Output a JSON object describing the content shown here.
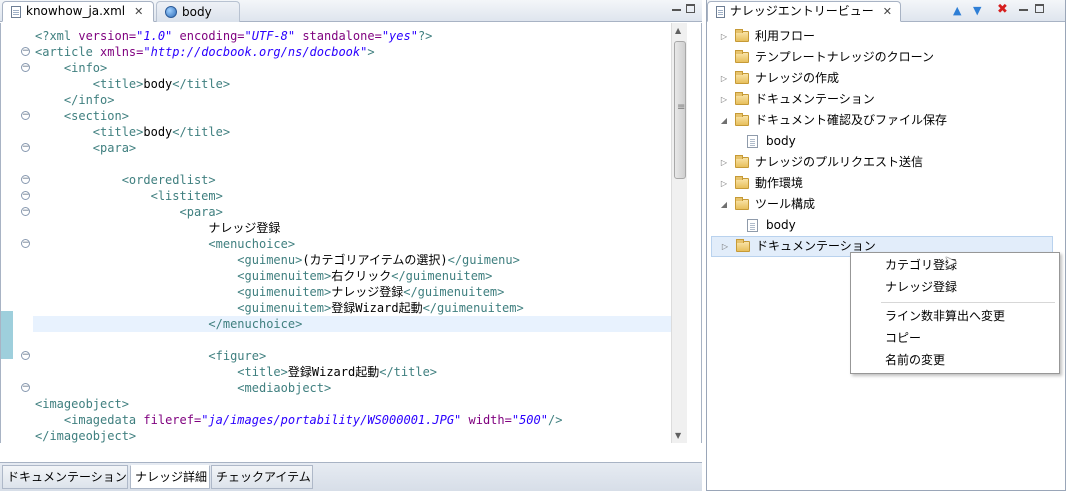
{
  "editor": {
    "tabs": [
      {
        "label": "knowhow_ja.xml",
        "close": "✕"
      },
      {
        "label": "body"
      }
    ],
    "lines": [
      {
        "indent": "",
        "parts": [
          {
            "c": "pi",
            "t": "<?xml "
          },
          {
            "c": "attr",
            "t": "version="
          },
          {
            "c": "val",
            "t": "\"1.0\""
          },
          {
            "c": "attr",
            "t": " encoding="
          },
          {
            "c": "val",
            "t": "\"UTF-8\""
          },
          {
            "c": "attr",
            "t": " standalone="
          },
          {
            "c": "val",
            "t": "\"yes\""
          },
          {
            "c": "pi",
            "t": "?>"
          }
        ]
      },
      {
        "indent": "",
        "parts": [
          {
            "c": "tag",
            "t": "<article "
          },
          {
            "c": "attr",
            "t": "xmlns="
          },
          {
            "c": "val",
            "t": "\"http://docbook.org/ns/docbook\""
          },
          {
            "c": "tag",
            "t": ">"
          }
        ]
      },
      {
        "indent": "    ",
        "parts": [
          {
            "c": "tag",
            "t": "<info>"
          }
        ]
      },
      {
        "indent": "        ",
        "parts": [
          {
            "c": "tag",
            "t": "<title>"
          },
          {
            "c": "txt",
            "t": "body"
          },
          {
            "c": "tag",
            "t": "</title>"
          }
        ]
      },
      {
        "indent": "    ",
        "parts": [
          {
            "c": "tag",
            "t": "</info>"
          }
        ]
      },
      {
        "indent": "    ",
        "parts": [
          {
            "c": "tag",
            "t": "<section>"
          }
        ]
      },
      {
        "indent": "        ",
        "parts": [
          {
            "c": "tag",
            "t": "<title>"
          },
          {
            "c": "txt",
            "t": "body"
          },
          {
            "c": "tag",
            "t": "</title>"
          }
        ]
      },
      {
        "indent": "        ",
        "parts": [
          {
            "c": "tag",
            "t": "<para>"
          }
        ]
      },
      {
        "indent": "",
        "parts": []
      },
      {
        "indent": "            ",
        "parts": [
          {
            "c": "tag",
            "t": "<orderedlist>"
          }
        ]
      },
      {
        "indent": "                ",
        "parts": [
          {
            "c": "tag",
            "t": "<listitem>"
          }
        ]
      },
      {
        "indent": "                    ",
        "parts": [
          {
            "c": "tag",
            "t": "<para>"
          }
        ]
      },
      {
        "indent": "                        ",
        "parts": [
          {
            "c": "txt",
            "t": "ナレッジ登録"
          }
        ]
      },
      {
        "indent": "                        ",
        "parts": [
          {
            "c": "tag",
            "t": "<menuchoice>"
          }
        ]
      },
      {
        "indent": "                            ",
        "parts": [
          {
            "c": "tag",
            "t": "<guimenu>"
          },
          {
            "c": "txt",
            "t": "(カテゴリアイテムの選択)"
          },
          {
            "c": "tag",
            "t": "</guimenu>"
          }
        ]
      },
      {
        "indent": "                            ",
        "parts": [
          {
            "c": "tag",
            "t": "<guimenuitem>"
          },
          {
            "c": "txt",
            "t": "右クリック"
          },
          {
            "c": "tag",
            "t": "</guimenuitem>"
          }
        ]
      },
      {
        "indent": "                            ",
        "parts": [
          {
            "c": "tag",
            "t": "<guimenuitem>"
          },
          {
            "c": "txt",
            "t": "ナレッジ登録"
          },
          {
            "c": "tag",
            "t": "</guimenuitem>"
          }
        ]
      },
      {
        "indent": "                            ",
        "parts": [
          {
            "c": "tag",
            "t": "<guimenuitem>"
          },
          {
            "c": "txt",
            "t": "登録Wizard起動"
          },
          {
            "c": "tag",
            "t": "</guimenuitem>"
          }
        ]
      },
      {
        "indent": "                        ",
        "parts": [
          {
            "c": "tag",
            "t": "</menuchoice>"
          }
        ],
        "highlight": true
      },
      {
        "indent": "",
        "parts": []
      },
      {
        "indent": "                        ",
        "parts": [
          {
            "c": "tag",
            "t": "<figure>"
          }
        ]
      },
      {
        "indent": "                            ",
        "parts": [
          {
            "c": "tag",
            "t": "<title>"
          },
          {
            "c": "txt",
            "t": "登録Wizard起動"
          },
          {
            "c": "tag",
            "t": "</title>"
          }
        ]
      },
      {
        "indent": "                            ",
        "parts": [
          {
            "c": "tag",
            "t": "<mediaobject>"
          }
        ]
      },
      {
        "indent": "",
        "parts": [
          {
            "c": "tag",
            "t": "<imageobject>"
          }
        ]
      },
      {
        "indent": "    ",
        "parts": [
          {
            "c": "tag",
            "t": "<imagedata "
          },
          {
            "c": "attr",
            "t": "fileref="
          },
          {
            "c": "val",
            "t": "\"ja/images/portability/WS000001.JPG\""
          },
          {
            "c": "attr",
            "t": " width="
          },
          {
            "c": "val",
            "t": "\"500\""
          },
          {
            "c": "tag",
            "t": "/>"
          }
        ]
      },
      {
        "indent": "",
        "parts": [
          {
            "c": "tag",
            "t": "</imageobject>"
          }
        ]
      }
    ],
    "fold_lines": [
      1,
      2,
      5,
      7,
      9,
      10,
      11,
      13,
      20,
      22
    ]
  },
  "bottom_tabs": [
    {
      "label": "ドキュメンテーション"
    },
    {
      "label": "ナレッジ詳細",
      "active": true
    },
    {
      "label": "チェックアイテム"
    }
  ],
  "tree_view": {
    "title": "ナレッジエントリービュー",
    "close": "✕",
    "items": [
      {
        "label": "利用フロー",
        "type": "folder",
        "twisty": "▷",
        "depth": 0
      },
      {
        "label": "テンプレートナレッジのクローン",
        "type": "folder",
        "twisty": "",
        "depth": 0
      },
      {
        "label": "ナレッジの作成",
        "type": "folder",
        "twisty": "▷",
        "depth": 0
      },
      {
        "label": "ドキュメンテーション",
        "type": "folder",
        "twisty": "▷",
        "depth": 0
      },
      {
        "label": "ドキュメント確認及びファイル保存",
        "type": "folder",
        "twisty": "◢",
        "depth": 0
      },
      {
        "label": "body",
        "type": "file",
        "twisty": "",
        "depth": 1
      },
      {
        "label": "ナレッジのプルリクエスト送信",
        "type": "folder",
        "twisty": "▷",
        "depth": 0
      },
      {
        "label": "動作環境",
        "type": "folder",
        "twisty": "▷",
        "depth": 0
      },
      {
        "label": "ツール構成",
        "type": "folder",
        "twisty": "◢",
        "depth": 0
      },
      {
        "label": "body",
        "type": "file",
        "twisty": "",
        "depth": 1
      },
      {
        "label": "ドキュメンテーション",
        "type": "folder",
        "twisty": "▷",
        "depth": 0,
        "selected": true
      }
    ]
  },
  "context_menu": {
    "items": [
      "カテゴリ登録",
      "ナレッジ登録",
      "ライン数非算出へ変更",
      "コピー",
      "名前の変更"
    ]
  }
}
